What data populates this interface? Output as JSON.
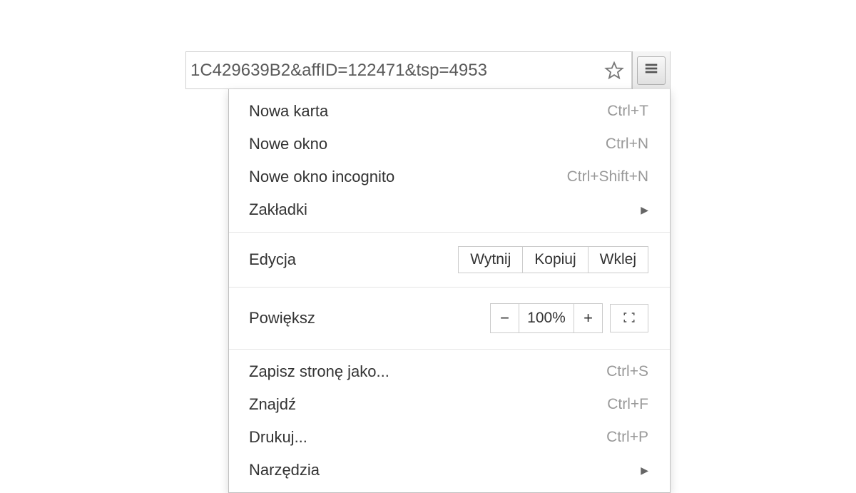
{
  "toolbar": {
    "url": "1C429639B2&affID=122471&tsp=4953"
  },
  "menu": {
    "section1": {
      "new_tab": {
        "label": "Nowa karta",
        "shortcut": "Ctrl+T"
      },
      "new_window": {
        "label": "Nowe okno",
        "shortcut": "Ctrl+N"
      },
      "new_incognito": {
        "label": "Nowe okno incognito",
        "shortcut": "Ctrl+Shift+N"
      },
      "bookmarks": {
        "label": "Zakładki"
      }
    },
    "section2": {
      "edit": {
        "label": "Edycja"
      },
      "cut": "Wytnij",
      "copy": "Kopiuj",
      "paste": "Wklej"
    },
    "section3": {
      "zoom": {
        "label": "Powiększ",
        "value": "100%"
      }
    },
    "section4": {
      "save_page": {
        "label": "Zapisz stronę jako...",
        "shortcut": "Ctrl+S"
      },
      "find": {
        "label": "Znajdź",
        "shortcut": "Ctrl+F"
      },
      "print": {
        "label": "Drukuj...",
        "shortcut": "Ctrl+P"
      },
      "tools": {
        "label": "Narzędzia"
      }
    }
  }
}
